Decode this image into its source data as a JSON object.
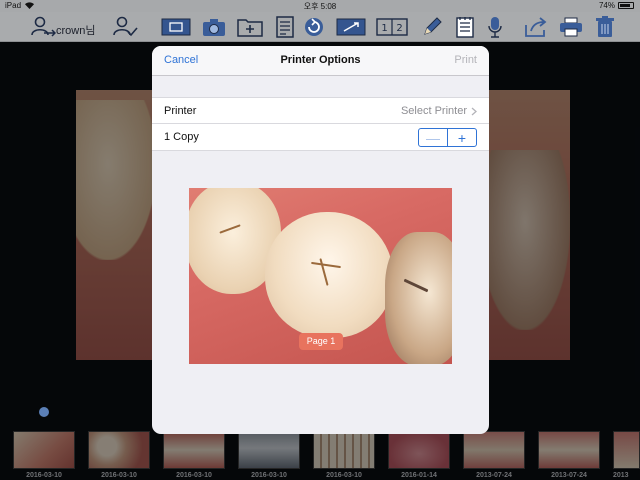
{
  "status_bar": {
    "device": "iPad",
    "time": "오후 5:08",
    "battery": "74%"
  },
  "toolbar": {
    "user_label": "crown님",
    "icons": [
      "user-switch-icon",
      "user-check-icon",
      "capture-icon",
      "camera-icon",
      "add-folder-icon",
      "report-icon",
      "rotate-icon",
      "compare-icon",
      "split-12-icon",
      "pencil-icon",
      "notes-icon",
      "microphone-icon",
      "share-icon",
      "printer-icon",
      "trash-icon"
    ],
    "split_labels": [
      "1",
      "2"
    ]
  },
  "modal": {
    "cancel_label": "Cancel",
    "title": "Printer Options",
    "print_label": "Print",
    "printer_label": "Printer",
    "printer_value": "Select Printer",
    "copies_label": "1 Copy",
    "stepper_minus": "—",
    "stepper_plus": "+",
    "page_badge": "Page 1"
  },
  "thumbnails": [
    {
      "date": "2016-03-10"
    },
    {
      "date": "2016-03-10"
    },
    {
      "date": "2016-03-10"
    },
    {
      "date": "2016-03-10"
    },
    {
      "date": "2016-03-10"
    },
    {
      "date": "2016-01-14"
    },
    {
      "date": "2013-07-24"
    },
    {
      "date": "2013-07-24"
    },
    {
      "date": "2013"
    }
  ],
  "colors": {
    "accent": "#2f73d6",
    "badge": "#e8735e",
    "toolbar": "#a9abad"
  }
}
